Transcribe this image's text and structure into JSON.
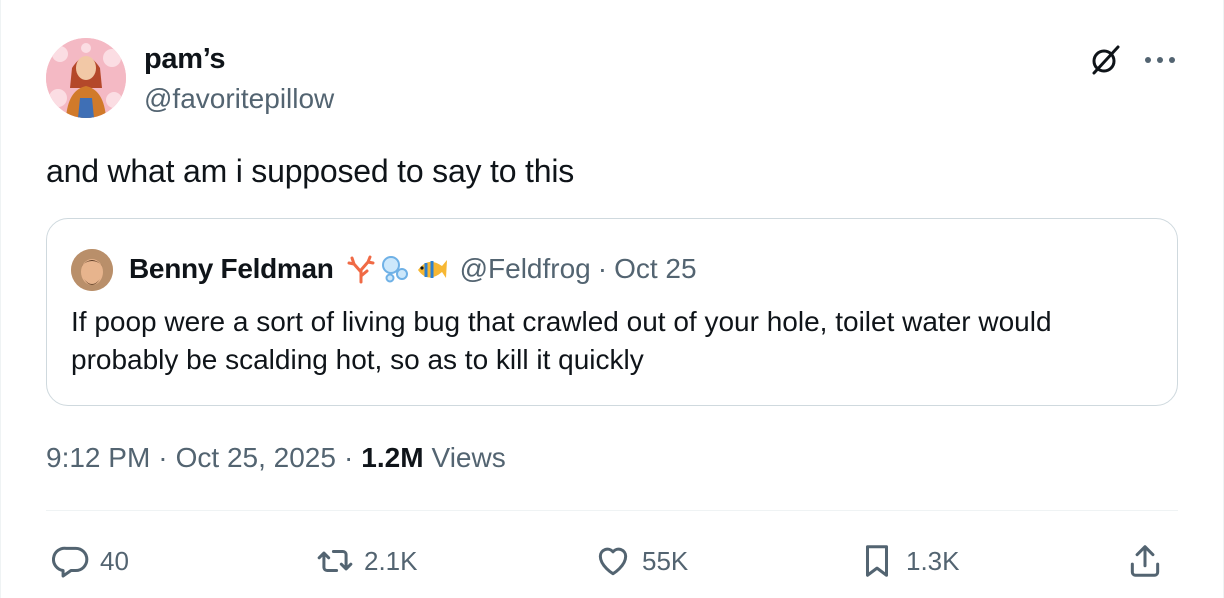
{
  "author": {
    "name": "pam’s",
    "handle": "@favoritepillow"
  },
  "tweet": {
    "text": "and what am i supposed to say to this"
  },
  "quoted": {
    "name": "Benny Feldman",
    "emojis": [
      "coral",
      "bubbles",
      "tropical-fish"
    ],
    "handle": "@Feldfrog",
    "separator": "·",
    "date": "Oct 25",
    "text": "If poop were a sort of living bug that crawled out of your hole, toilet water would probably be scalding hot, so as to kill it quickly"
  },
  "meta": {
    "time": "9:12 PM",
    "separator": "·",
    "date": "Oct 25, 2025",
    "views_count": "1.2M",
    "views_label": "Views"
  },
  "actions": {
    "replies": "40",
    "reposts": "2.1K",
    "likes": "55K",
    "bookmarks": "1.3K"
  },
  "icons": {
    "grok": "grok-icon",
    "more": "more-icon",
    "reply": "reply-icon",
    "repost": "repost-icon",
    "like": "heart-icon",
    "bookmark": "bookmark-icon",
    "share": "share-icon"
  },
  "colors": {
    "text": "#0f1419",
    "secondary": "#536471",
    "border": "#cfd9de"
  }
}
